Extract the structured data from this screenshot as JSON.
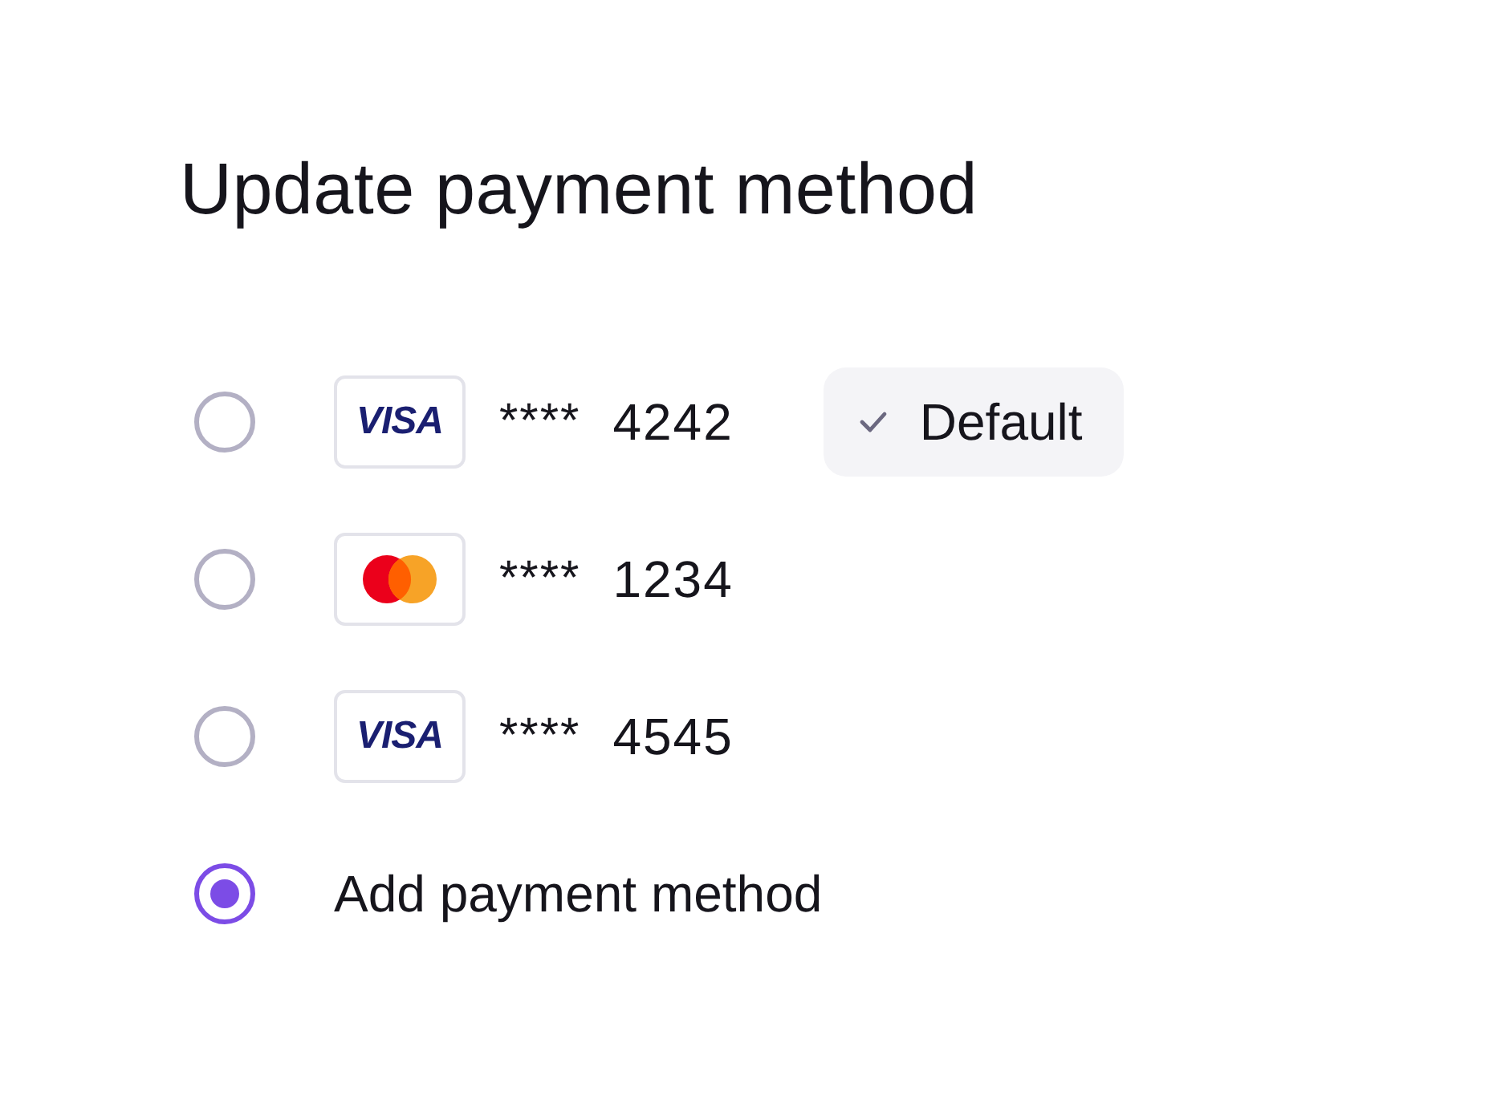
{
  "title": "Update payment method",
  "options": [
    {
      "kind": "visa",
      "logo": "VISA",
      "mask": "****",
      "last4": "4242",
      "selected": false,
      "default_badge": "Default"
    },
    {
      "kind": "mastercard",
      "mask": "****",
      "last4": "1234",
      "selected": false
    },
    {
      "kind": "visa",
      "logo": "VISA",
      "mask": "****",
      "last4": "4545",
      "selected": false
    },
    {
      "kind": "add",
      "label": "Add payment method",
      "selected": true
    }
  ]
}
